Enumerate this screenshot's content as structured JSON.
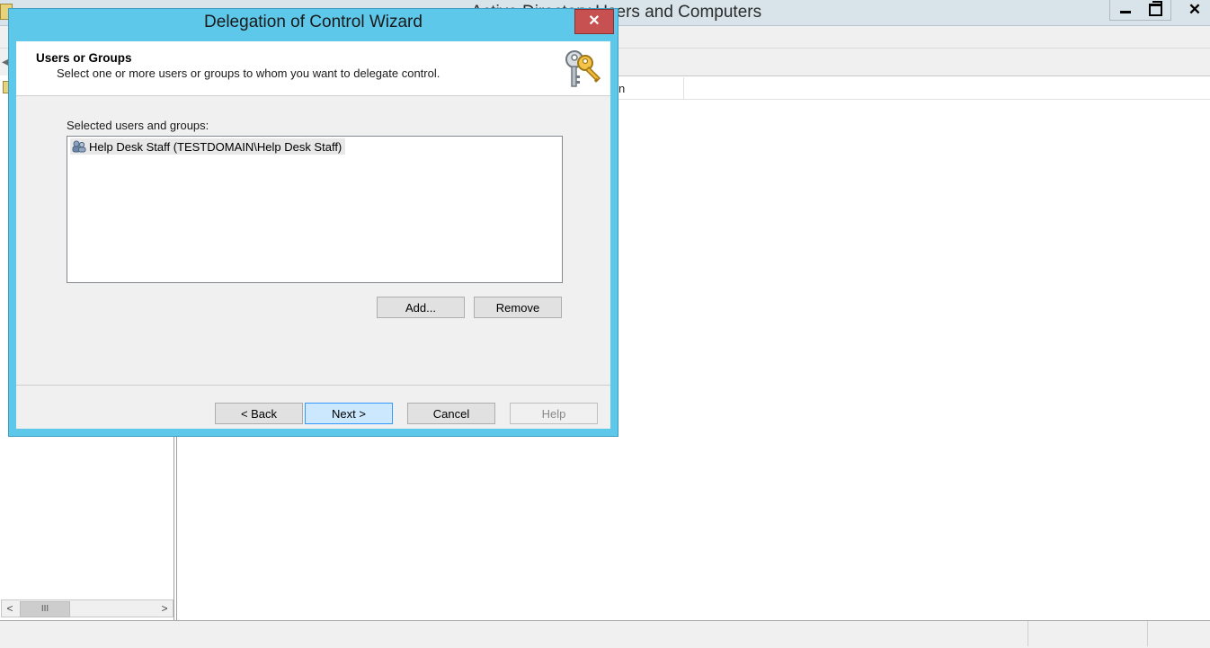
{
  "main_window": {
    "title": "Active Directory Users and Computers",
    "column_header": "n",
    "controls": {
      "minimize": "minimize",
      "restore": "restore",
      "close": "✕"
    }
  },
  "left_pane": {
    "scroll_left": "<",
    "scroll_thumb": "III",
    "scroll_right": ">"
  },
  "dialog": {
    "title": "Delegation of Control Wizard",
    "close_label": "✕",
    "header_title": "Users or Groups",
    "header_subtitle": "Select one or more users or groups to whom you want to delegate control.",
    "header_icon": "keys-icon",
    "list_label": "Selected users and groups:",
    "list_items": [
      {
        "label": "Help Desk Staff (TESTDOMAIN\\Help Desk Staff)",
        "icon": "group-icon"
      }
    ],
    "buttons": {
      "add": "Add...",
      "remove": "Remove",
      "back": "< Back",
      "next": "Next >",
      "cancel": "Cancel",
      "help": "Help"
    }
  },
  "colors": {
    "dialog_frame": "#5ec8eb",
    "close_button": "#c75050",
    "default_button": "#cce8ff"
  }
}
